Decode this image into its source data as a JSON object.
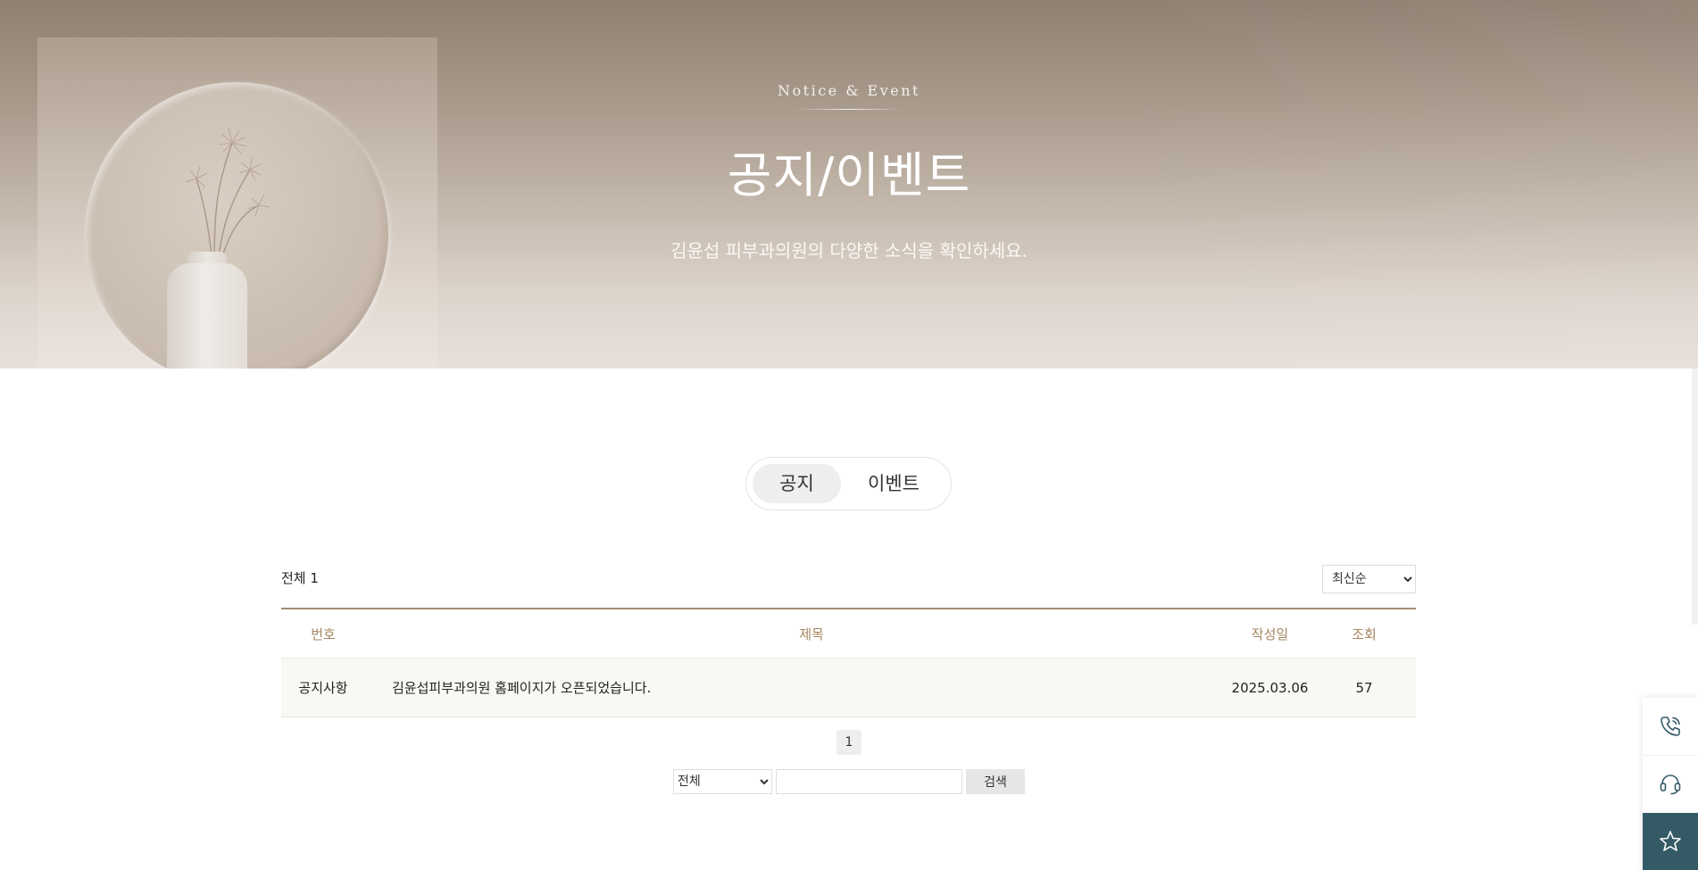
{
  "hero": {
    "eyebrow": "Notice & Event",
    "title": "공지/이벤트",
    "subtitle": "김윤섭 피부과의원의 다양한 소식을 확인하세요."
  },
  "tabs": [
    {
      "label": "공지",
      "active": true
    },
    {
      "label": "이벤트",
      "active": false
    }
  ],
  "board": {
    "total_label": "전체",
    "total_count": "1",
    "sort_selected": "최신순",
    "columns": {
      "no": "번호",
      "title": "제목",
      "date": "작성일",
      "views": "조회"
    },
    "rows": [
      {
        "no": "공지사항",
        "title": "김윤섭피부과의원 홈페이지가 오픈되었습니다.",
        "date": "2025.03.06",
        "views": "57"
      }
    ]
  },
  "pagination": {
    "current": "1"
  },
  "search": {
    "field_selected": "전체",
    "query": "",
    "button_label": "검색"
  },
  "quick_menu": {
    "items": [
      "phone-icon",
      "headset-icon",
      "star-icon"
    ],
    "fav_color": "#345a66"
  },
  "colors": {
    "accent": "#a5865f",
    "table_border": "#a58c70"
  }
}
